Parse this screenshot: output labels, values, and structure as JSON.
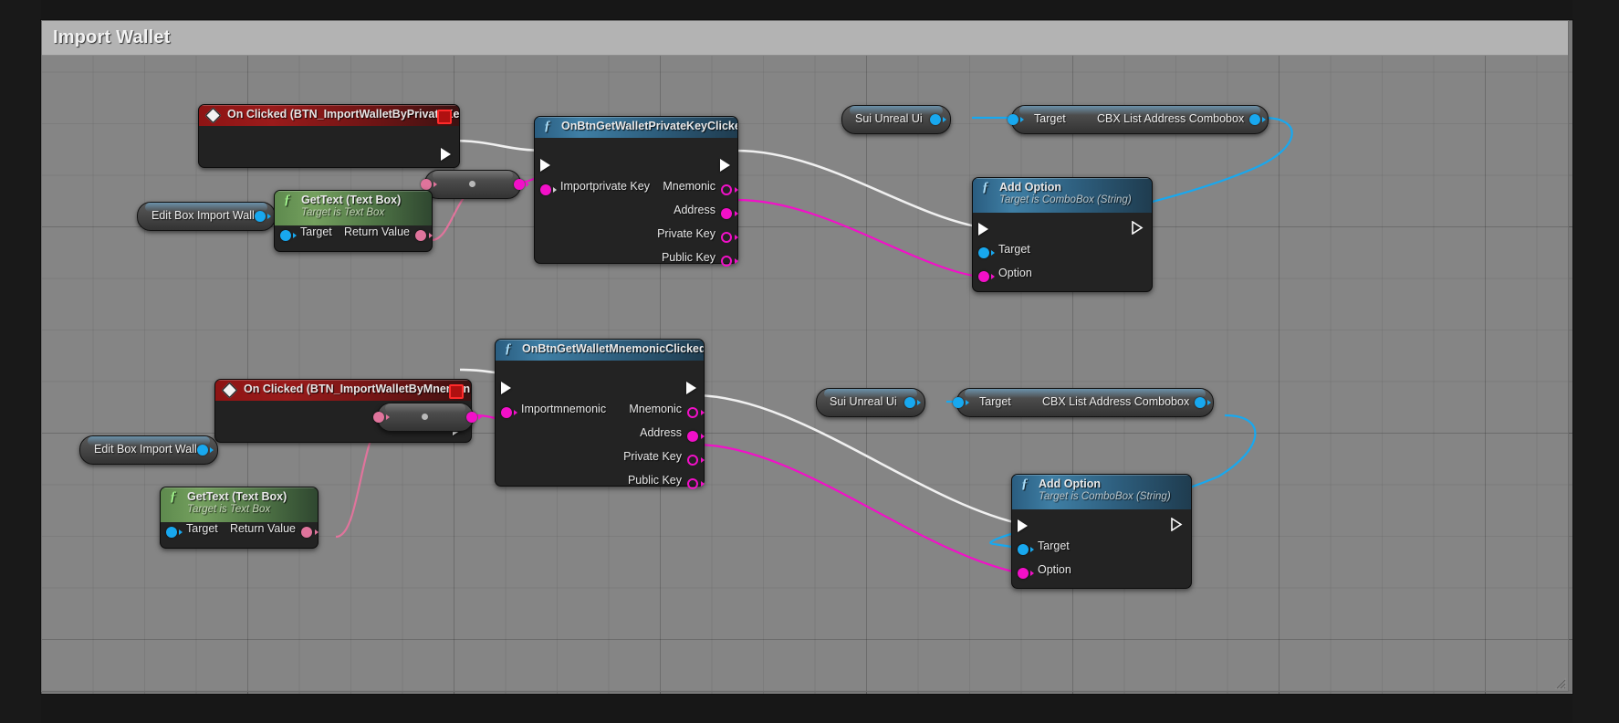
{
  "window": {
    "title": "Import Wallet"
  },
  "comment": {
    "title": "Import Wallet"
  },
  "nodes": {
    "event_privatekey": {
      "title": "On Clicked (BTN_ImportWalletByPrivateKey)",
      "icon": "event-diamond-icon",
      "breakpoint": "breakpoint-icon"
    },
    "event_mnemonic": {
      "title": "On Clicked (BTN_ImportWalletByMnemonic)",
      "icon": "event-diamond-icon",
      "breakpoint": "breakpoint-icon"
    },
    "fn_privatekey": {
      "title": "OnBtnGetWalletPrivateKeyClicked",
      "icon": "function-icon",
      "inputs": [
        "Importprivate Key"
      ],
      "outputs": [
        "Mnemonic",
        "Address",
        "Private Key",
        "Public Key"
      ]
    },
    "fn_mnemonic": {
      "title": "OnBtnGetWalletMnemonicClicked",
      "icon": "function-icon",
      "inputs": [
        "Importmnemonic"
      ],
      "outputs": [
        "Mnemonic",
        "Address",
        "Private Key",
        "Public Key"
      ]
    },
    "gettext_top": {
      "title": "GetText (Text Box)",
      "subtitle": "Target is Text Box",
      "icon": "function-icon",
      "input_pin": "Target",
      "output_pin": "Return Value"
    },
    "gettext_bottom": {
      "title": "GetText (Text Box)",
      "subtitle": "Target is Text Box",
      "icon": "function-icon",
      "input_pin": "Target",
      "output_pin": "Return Value"
    },
    "editbox_top": {
      "label": "Edit Box Import Wallet"
    },
    "editbox_bottom": {
      "label": "Edit Box Import Wallet"
    },
    "suiui_top": {
      "label": "Sui Unreal Ui"
    },
    "suiui_bottom": {
      "label": "Sui Unreal Ui"
    },
    "combobox_top": {
      "target_label": "Target",
      "label": "CBX List Address Combobox"
    },
    "combobox_bottom": {
      "target_label": "Target",
      "label": "CBX List Address Combobox"
    },
    "addoption_top": {
      "title": "Add Option",
      "subtitle": "Target is ComboBox (String)",
      "icon": "function-icon",
      "inputs": [
        "Target",
        "Option"
      ]
    },
    "addoption_bottom": {
      "title": "Add Option",
      "subtitle": "Target is ComboBox (String)",
      "icon": "function-icon",
      "inputs": [
        "Target",
        "Option"
      ]
    },
    "convert_top": {
      "name": "text-to-string-conversion-node"
    },
    "convert_bottom": {
      "name": "text-to-string-conversion-node"
    }
  },
  "colors": {
    "exec_wire": "#f0f0f0",
    "object_wire": "#18a8ef",
    "string_wire": "#f210c8",
    "text_wire": "#e0749c",
    "event_header": "#8d1414",
    "function_header": "#3f7fa5",
    "pure_function_header": "#74a05e",
    "breakpoint": "#ff2a2a",
    "canvas": "#7a7a7a",
    "node_body": "#232323"
  }
}
